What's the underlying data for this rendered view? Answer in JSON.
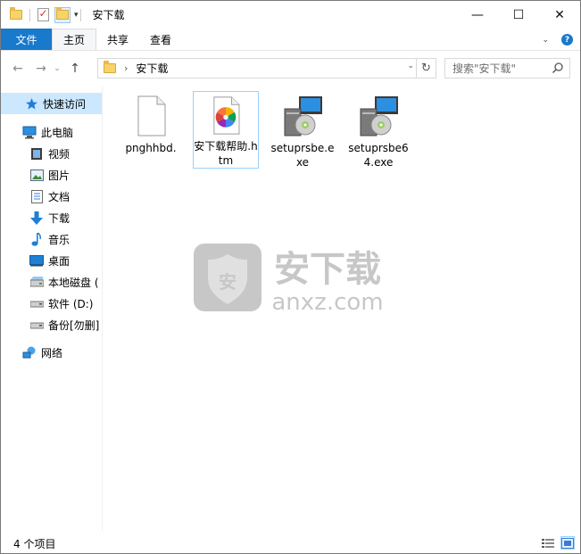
{
  "window": {
    "title": "安下载",
    "controls": {
      "minimize": "—",
      "maximize": "☐",
      "close": "✕"
    }
  },
  "ribbon": {
    "tabs": [
      {
        "label": "文件"
      },
      {
        "label": "主页"
      },
      {
        "label": "共享"
      },
      {
        "label": "查看"
      }
    ]
  },
  "address": {
    "path_segments": [
      "安下载"
    ],
    "search_placeholder": "搜索\"安下载\""
  },
  "nav": {
    "items": [
      {
        "label": "快速访问",
        "icon": "star-icon"
      },
      {
        "label": "此电脑",
        "icon": "pc-icon"
      },
      {
        "label": "视频",
        "icon": "video-icon"
      },
      {
        "label": "图片",
        "icon": "pictures-icon"
      },
      {
        "label": "文档",
        "icon": "documents-icon"
      },
      {
        "label": "下载",
        "icon": "download-icon"
      },
      {
        "label": "音乐",
        "icon": "music-icon"
      },
      {
        "label": "桌面",
        "icon": "desktop-icon"
      },
      {
        "label": "本地磁盘 (",
        "icon": "drive-icon"
      },
      {
        "label": "软件 (D:)",
        "icon": "drive-icon"
      },
      {
        "label": "备份[勿删]",
        "icon": "drive-icon"
      },
      {
        "label": "网络",
        "icon": "network-icon"
      }
    ]
  },
  "files": [
    {
      "name": "pnghhbd.",
      "icon": "blank-file-icon"
    },
    {
      "name": "安下载帮助.htm",
      "icon": "html-file-icon"
    },
    {
      "name": "setuprsbe.exe",
      "icon": "installer-icon"
    },
    {
      "name": "setuprsbe64.exe",
      "icon": "installer-icon"
    }
  ],
  "watermark": {
    "text_cn": "安下载",
    "text_en": "anxz.com"
  },
  "status": {
    "item_count": "4 个项目"
  }
}
